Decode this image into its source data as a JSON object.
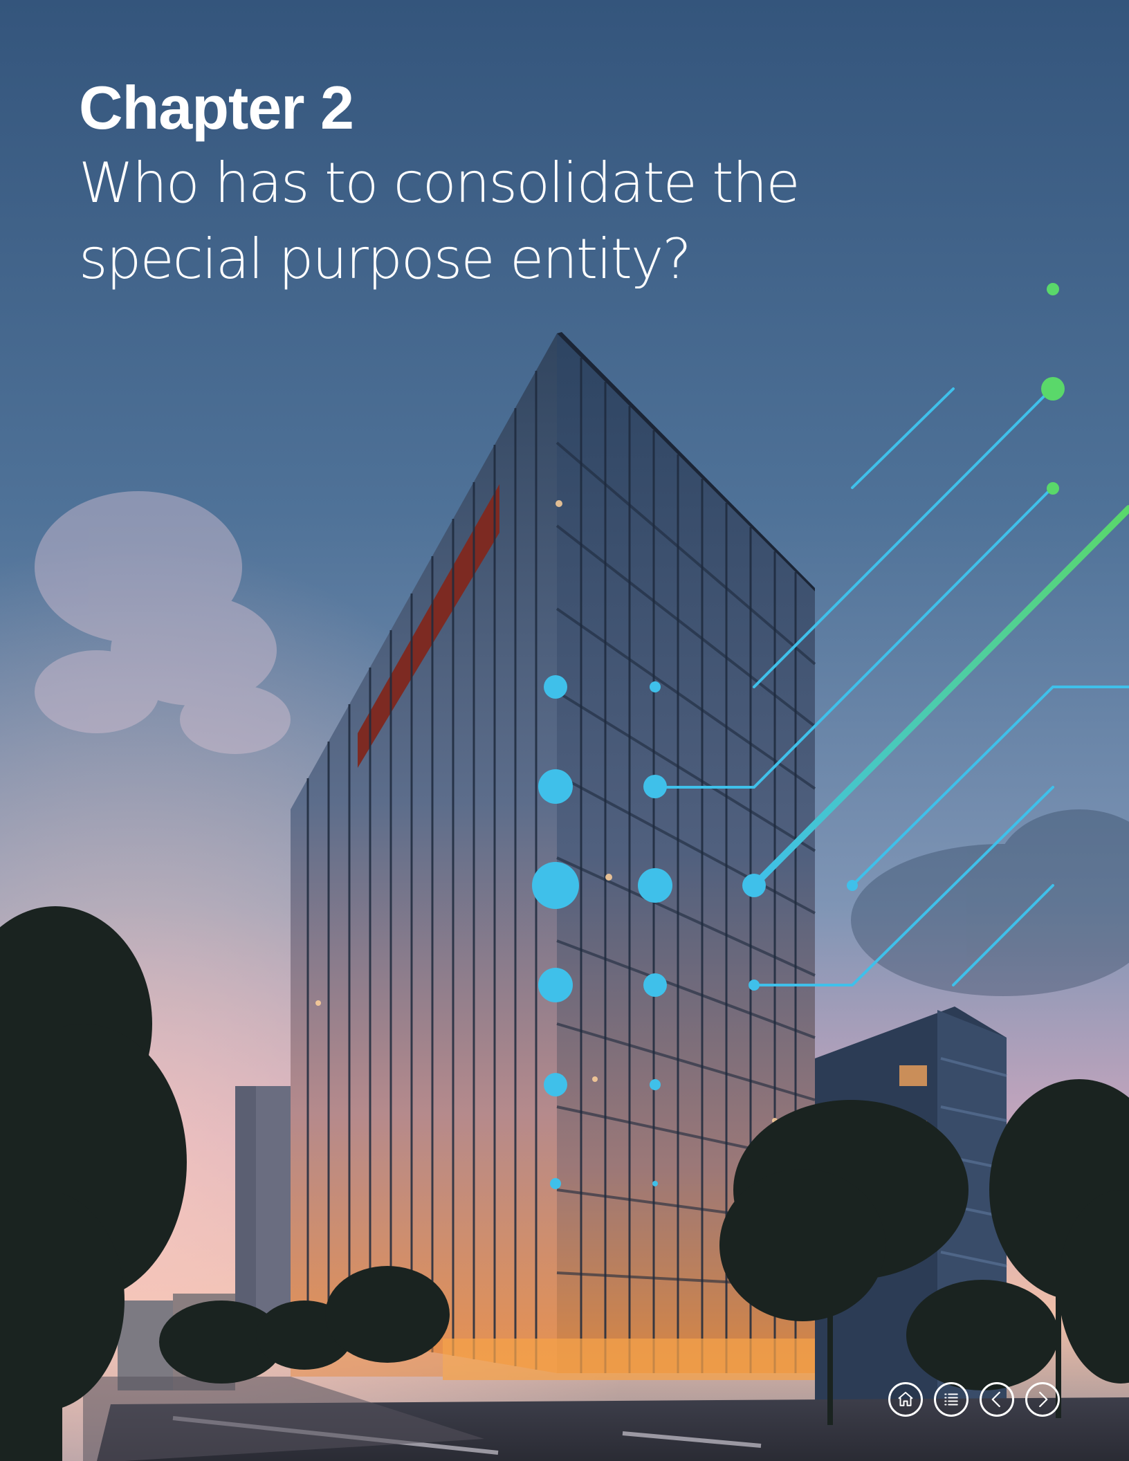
{
  "chapter": {
    "label": "Chapter 2",
    "title": "Who has to consolidate the special purpose entity?"
  },
  "navigation": [
    {
      "name": "home",
      "icon": "home-icon"
    },
    {
      "name": "contents",
      "icon": "list-icon"
    },
    {
      "name": "previous",
      "icon": "chevron-left-icon"
    },
    {
      "name": "next",
      "icon": "chevron-right-icon"
    }
  ],
  "colors": {
    "sky_top": "#35577f",
    "sky_horizon": "#e8b4c0",
    "accent_blue": "#3fc0ea",
    "accent_green": "#5ad86a",
    "text": "#ffffff"
  }
}
